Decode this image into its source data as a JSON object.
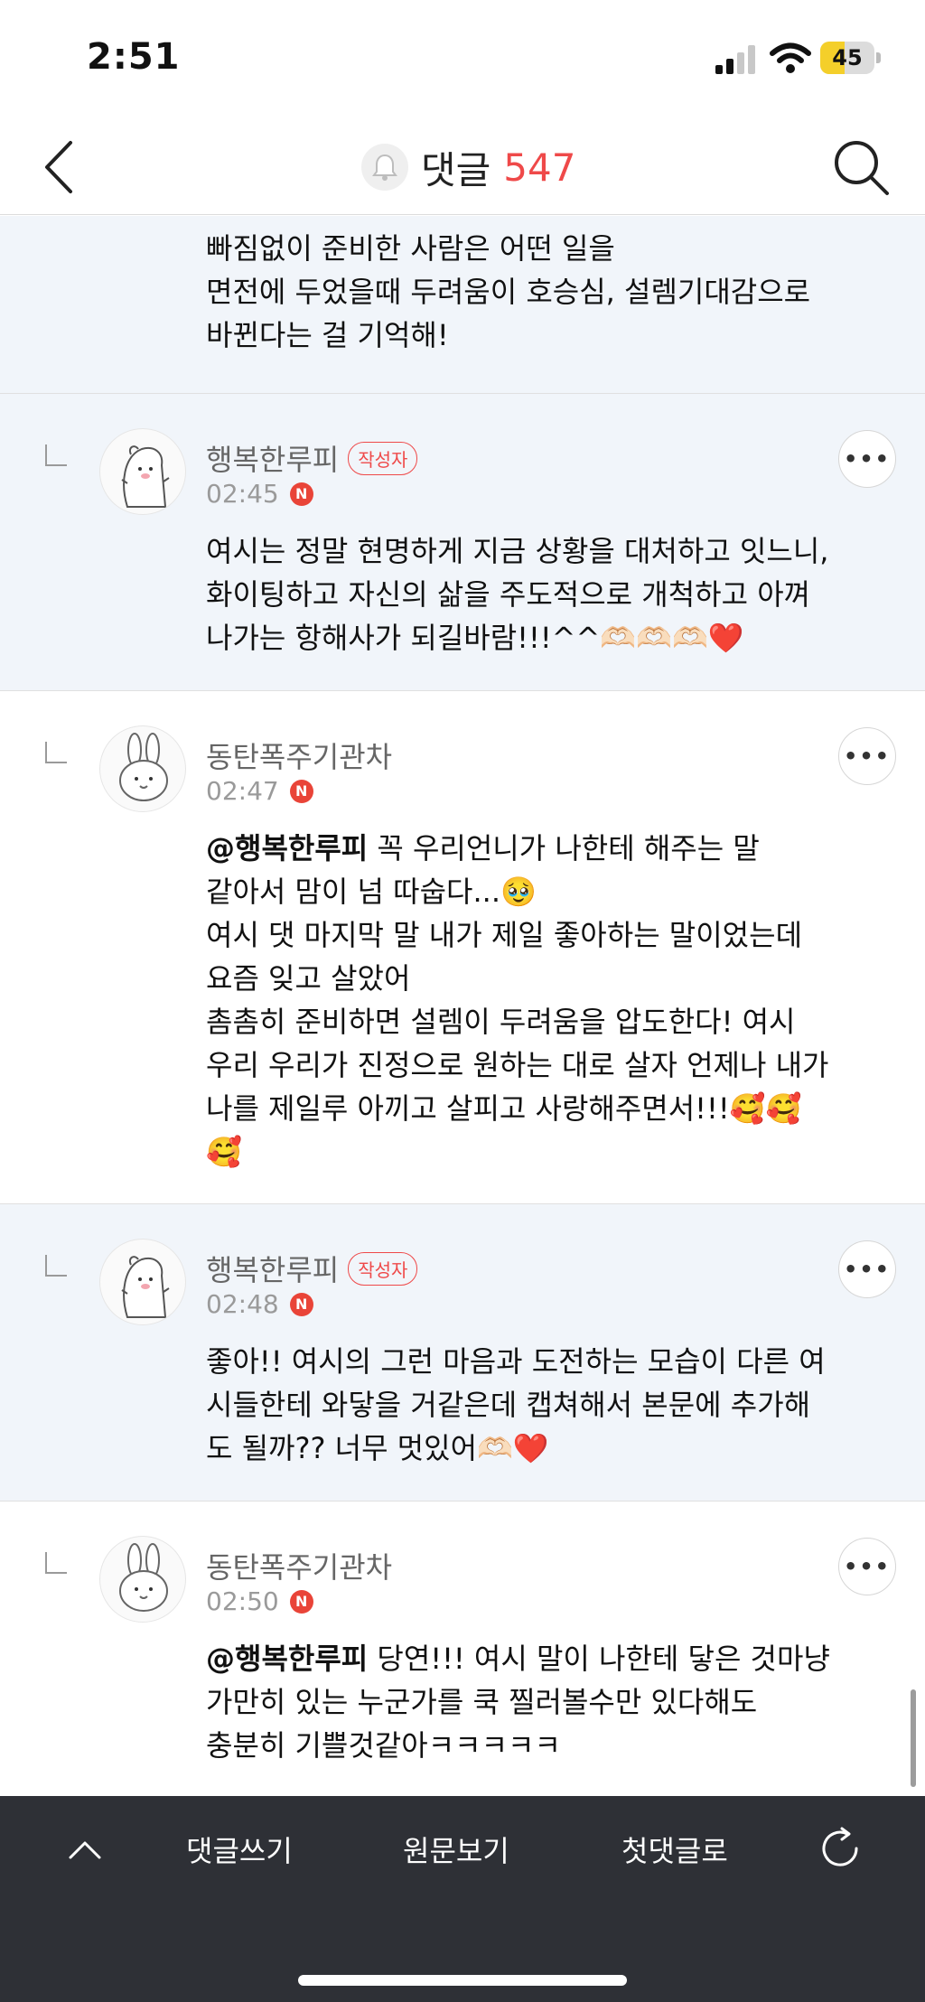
{
  "status_bar": {
    "time": "2:51",
    "battery": "45",
    "battery_level": 0.45,
    "battery_color": "#f4cf2a"
  },
  "nav": {
    "title": "댓글",
    "count": "547",
    "count_color": "#ef4949",
    "back_icon": "chevron-left-icon",
    "search_icon": "search-icon",
    "bell_icon": "bell-icon"
  },
  "comments": [
    {
      "body": "빠짐없이 준비한 사람은 어떤 일을\n면전에 두었을때 두려움이 호승심, 설렘기대감으로\n바뀐다는 걸 기억해!"
    },
    {
      "nickname": "행복한루피",
      "badge": "작성자",
      "time": "02:45",
      "body": "여시는 정말 현명하게 지금 상황을 대처하고 잇느니,\n화이팅하고 자신의 삶을 주도적으로 개척하고 아껴\n나가는 항해사가 되길바람!!!^^🫶🏻🫶🏻🫶🏻❤️"
    },
    {
      "nickname": "동탄폭주기관차",
      "time": "02:47",
      "mention": "@행복한루피",
      "body": "  꼭 우리언니가 나한테 해주는 말\n같아서 맘이 넘 따숩다...🥹\n여시 댓 마지막 말 내가 제일 좋아하는 말이었는데\n요즘 잊고 살았어\n촘촘히 준비하면 설렘이 두려움을 압도한다! 여시\n우리 우리가 진정으로 원하는 대로 살자 언제나 내가\n나를 제일루 아끼고 살피고 사랑해주면서!!!🥰🥰\n🥰"
    },
    {
      "nickname": "행복한루피",
      "badge": "작성자",
      "time": "02:48",
      "body": "좋아!! 여시의 그런 마음과 도전하는 모습이 다른 여\n시들한테 와닿을 거같은데 캡쳐해서 본문에 추가해\n도 될까?? 너무 멋있어🫶🏻❤️"
    },
    {
      "nickname": "동탄폭주기관차",
      "time": "02:50",
      "mention": "@행복한루피",
      "body": "  당연!!! 여시 말이 나한테 닿은 것마냥\n가만히 있는 누군가를 쿡 찔러볼수만 있다해도\n충분히 기쁠것같아ㅋㅋㅋㅋㅋ"
    }
  ],
  "badge_color": "#ef4949",
  "bottom_bar": {
    "write": "댓글쓰기",
    "original": "원문보기",
    "first": "첫댓글로",
    "up_icon": "chevron-up-icon",
    "refresh_icon": "refresh-icon"
  }
}
